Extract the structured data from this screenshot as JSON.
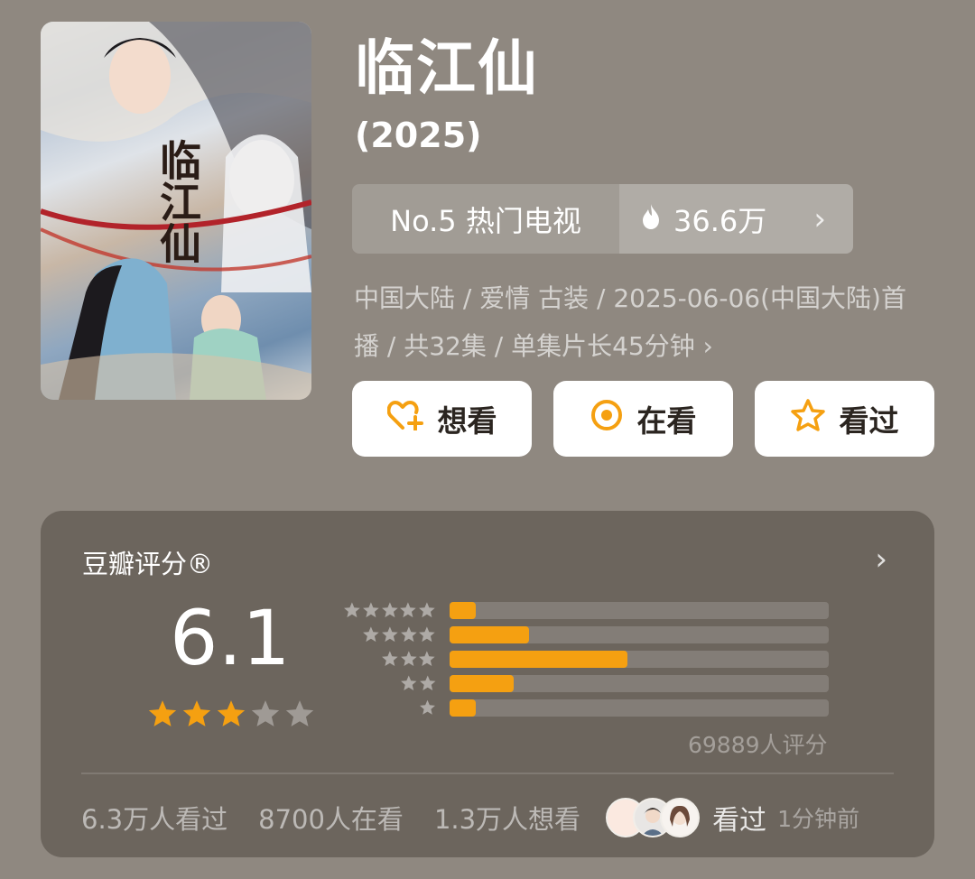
{
  "show": {
    "title": "临江仙",
    "year": "(2025)",
    "poster_title": "临江仙"
  },
  "rank": {
    "label": "No.5 热门电视",
    "heat": "36.6万",
    "heat_icon": "flame-icon",
    "chevron_icon": "chevron-right-icon"
  },
  "meta": {
    "text": "中国大陆 / 爱情 古装 / 2025-06-06(中国大陆)首播 / 共32集 / 单集片长45分钟",
    "chevron": "›"
  },
  "actions": [
    {
      "label": "想看",
      "icon": "heart-plus-icon"
    },
    {
      "label": "在看",
      "icon": "target-icon"
    },
    {
      "label": "看过",
      "icon": "star-outline-icon"
    }
  ],
  "rating": {
    "title": "豆瓣评分®",
    "score": "6.1",
    "stars_value": 3,
    "stars_max": 5,
    "distribution": [
      {
        "stars": 5,
        "fraction": 0.07
      },
      {
        "stars": 4,
        "fraction": 0.21
      },
      {
        "stars": 3,
        "fraction": 0.47
      },
      {
        "stars": 2,
        "fraction": 0.17
      },
      {
        "stars": 1,
        "fraction": 0.07
      }
    ],
    "votes": "69889人评分"
  },
  "stats": {
    "watched": "6.3万人看过",
    "watching": "8700人在看",
    "want": "1.3万人想看",
    "seen_label": "看过",
    "seen_time": "1分钟前"
  },
  "colors": {
    "accent": "#f5a011",
    "background": "#8f8880"
  }
}
